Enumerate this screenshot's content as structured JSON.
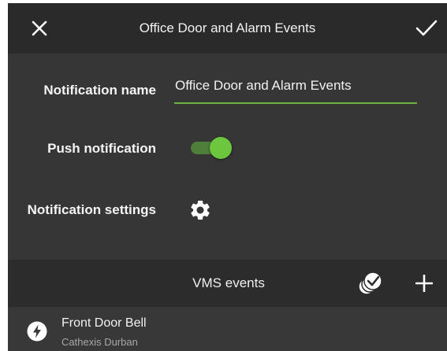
{
  "header": {
    "title": "Office Door and Alarm Events",
    "close_icon": "close-icon",
    "confirm_icon": "checkmark-icon"
  },
  "form": {
    "name_label": "Notification name",
    "name_value": "Office Door and Alarm Events",
    "push_label": "Push notification",
    "push_enabled": true,
    "settings_label": "Notification settings",
    "settings_icon": "gear-icon"
  },
  "vms_section": {
    "title": "VMS events",
    "select_all_icon": "multi-check-icon",
    "add_icon": "plus-icon"
  },
  "events": [
    {
      "name": "Front Door Bell",
      "site": "Cathexis Durban",
      "icon": "lightning-icon"
    }
  ],
  "colors": {
    "accent": "#6db33f",
    "toggle_thumb": "#6cc63e",
    "toggle_track": "#4f7d3a",
    "header_bg": "#2a2a2a",
    "panel_bg": "#363636",
    "text": "#f2f2f2",
    "subtext": "#a8a8a8"
  }
}
